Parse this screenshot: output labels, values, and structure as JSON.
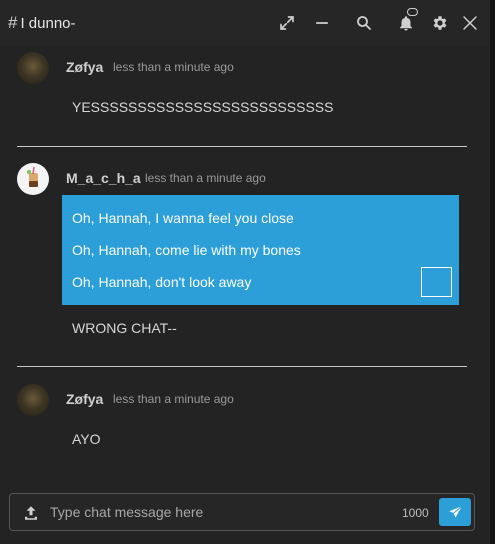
{
  "header": {
    "hash": "#",
    "title": "I dunno-"
  },
  "messages": [
    {
      "author": "Zøfya",
      "time": "less than a minute ago",
      "text": "YESSSSSSSSSSSSSSSSSSSSSSSSSS"
    },
    {
      "author": "M_a_c_h_a",
      "time": "less than a minute ago",
      "quote": [
        "Oh, Hannah, I wanna feel you close",
        "Oh, Hannah, come lie with my bones",
        "Oh, Hannah, don't look away"
      ],
      "text": "WRONG CHAT--"
    },
    {
      "author": "Zøfya",
      "time": "less than a minute ago",
      "text": "AYO"
    }
  ],
  "composer": {
    "placeholder": "Type chat message here",
    "char_limit": "1000"
  },
  "colors": {
    "accent": "#2c9fd9",
    "background": "#232323"
  },
  "icons": {
    "expand": "expand-icon",
    "minimize": "minimize-icon",
    "search": "search-icon",
    "notifications": "bell-icon",
    "settings": "gear-icon",
    "close": "close-icon",
    "upload": "upload-icon",
    "send": "send-icon"
  }
}
